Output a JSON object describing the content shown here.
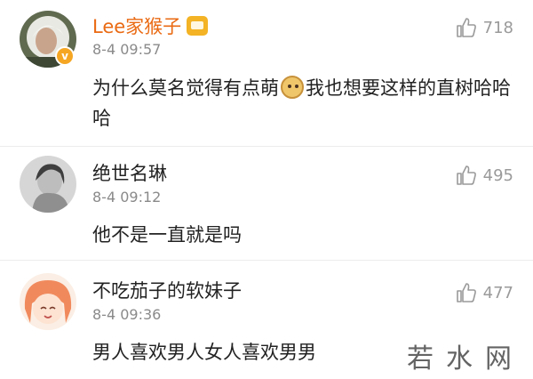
{
  "comments": [
    {
      "username": "Lee家猴子",
      "time": "8-4 09:57",
      "likes": "718",
      "text_before": "为什么莫名觉得有点萌",
      "text_after": "我也想要这样的直树哈哈哈",
      "name_color": "#ea6a13",
      "badge_glyph": "v",
      "emoji": "doge-emoji"
    },
    {
      "username": "绝世名琳",
      "time": "8-4 09:12",
      "likes": "495",
      "text": "他不是一直就是吗"
    },
    {
      "username": "不吃茄子的软妹子",
      "time": "8-4 09:36",
      "likes": "477",
      "text": "男人喜欢男人女人喜欢男男"
    }
  ],
  "watermark": "若水网",
  "icons": {
    "like": "thumbs-up-icon",
    "verified": "verified-badge-icon",
    "member": "crown-icon"
  }
}
